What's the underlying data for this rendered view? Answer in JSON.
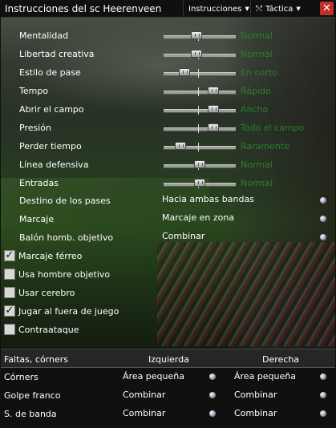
{
  "window": {
    "title": "Instrucciones del sc Heerenveen"
  },
  "toolbar": {
    "instructions_label": "Instrucciones",
    "tactic_label": "Táctica",
    "close_label": "✕"
  },
  "sliders": [
    {
      "label": "Mentalidad",
      "value": "Normal",
      "level": 0.45
    },
    {
      "label": "Libertad creativa",
      "value": "Normal",
      "level": 0.45
    },
    {
      "label": "Estilo de pase",
      "value": "En corto",
      "level": 0.25
    },
    {
      "label": "Tempo",
      "value": "Rápido",
      "level": 0.73
    },
    {
      "label": "Abrir el campo",
      "value": "Ancho",
      "level": 0.73
    },
    {
      "label": "Presión",
      "value": "Todo el campo",
      "level": 0.73
    },
    {
      "label": "Perder tiempo",
      "value": "Raramente",
      "level": 0.18
    },
    {
      "label": "Línea defensiva",
      "value": "Normal",
      "level": 0.5
    },
    {
      "label": "Entradas",
      "value": "Normal",
      "level": 0.5
    }
  ],
  "dropdowns": [
    {
      "label": "Destino de los pases",
      "value": "Hacia ambas bandas"
    },
    {
      "label": "Marcaje",
      "value": "Marcaje en zona"
    },
    {
      "label": "Balón homb. objetivo",
      "value": "Combinar"
    }
  ],
  "checkboxes": [
    {
      "label": "Marcaje férreo",
      "checked": true,
      "mark": "✓"
    },
    {
      "label": "Usa hombre objetivo",
      "checked": false,
      "mark": ""
    },
    {
      "label": "Usar cerebro",
      "checked": false,
      "mark": ""
    },
    {
      "label": "Jugar al fuera de juego",
      "checked": true,
      "mark": "✓"
    },
    {
      "label": "Contraataque",
      "checked": false,
      "mark": ""
    }
  ],
  "set_pieces": {
    "header": {
      "title": "Faltas, córners",
      "left": "Izquierda",
      "right": "Derecha"
    },
    "rows": [
      {
        "label": "Córners",
        "left": "Área pequeña",
        "right": "Área pequeña"
      },
      {
        "label": "Golpe franco",
        "left": "Combinar",
        "right": "Combinar"
      },
      {
        "label": "S. de banda",
        "left": "Combinar",
        "right": "Combinar"
      }
    ]
  },
  "colors": {
    "value_green": "#2f7d2c",
    "close_red": "#c0302a"
  },
  "icons": {
    "dropdown": "dropdown-arrow-icon",
    "tactic": "tactic-arrows-icon"
  }
}
